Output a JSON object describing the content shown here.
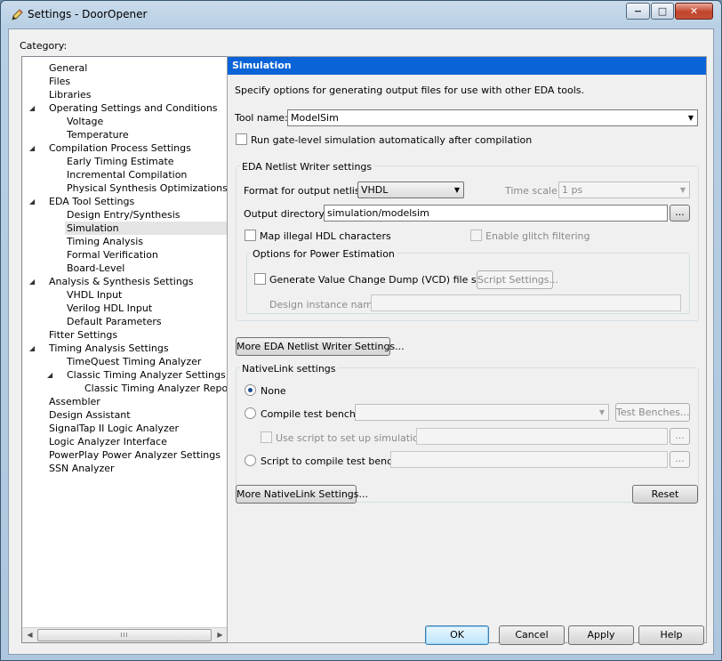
{
  "window": {
    "title": "Settings - DoorOpener",
    "controls": {
      "minimize": "−",
      "maximize": "□",
      "close": "✕"
    },
    "title_icon": "pencil-icon"
  },
  "category": {
    "label": "Category:",
    "items": [
      {
        "label": "General",
        "level": 0
      },
      {
        "label": "Files",
        "level": 0
      },
      {
        "label": "Libraries",
        "level": 0
      },
      {
        "label": "Operating Settings and Conditions",
        "level": 0,
        "expanded": true
      },
      {
        "label": "Voltage",
        "level": 1
      },
      {
        "label": "Temperature",
        "level": 1
      },
      {
        "label": "Compilation Process Settings",
        "level": 0,
        "expanded": true
      },
      {
        "label": "Early Timing Estimate",
        "level": 1
      },
      {
        "label": "Incremental Compilation",
        "level": 1
      },
      {
        "label": "Physical Synthesis Optimizations",
        "level": 1
      },
      {
        "label": "EDA Tool Settings",
        "level": 0,
        "expanded": true
      },
      {
        "label": "Design Entry/Synthesis",
        "level": 1
      },
      {
        "label": "Simulation",
        "level": 1,
        "selected": true
      },
      {
        "label": "Timing Analysis",
        "level": 1
      },
      {
        "label": "Formal Verification",
        "level": 1
      },
      {
        "label": "Board-Level",
        "level": 1
      },
      {
        "label": "Analysis & Synthesis Settings",
        "level": 0,
        "expanded": true
      },
      {
        "label": "VHDL Input",
        "level": 1
      },
      {
        "label": "Verilog HDL Input",
        "level": 1
      },
      {
        "label": "Default Parameters",
        "level": 1
      },
      {
        "label": "Fitter Settings",
        "level": 0
      },
      {
        "label": "Timing Analysis Settings",
        "level": 0,
        "expanded": true
      },
      {
        "label": "TimeQuest Timing Analyzer",
        "level": 1
      },
      {
        "label": "Classic Timing Analyzer Settings",
        "level": 1,
        "expanded": true
      },
      {
        "label": "Classic Timing Analyzer Reporting",
        "level": 2
      },
      {
        "label": "Assembler",
        "level": 0
      },
      {
        "label": "Design Assistant",
        "level": 0
      },
      {
        "label": "SignalTap II Logic Analyzer",
        "level": 0
      },
      {
        "label": "Logic Analyzer Interface",
        "level": 0
      },
      {
        "label": "PowerPlay Power Analyzer Settings",
        "level": 0
      },
      {
        "label": "SSN Analyzer",
        "level": 0
      }
    ],
    "scroll_thumb": "III",
    "scroll_left": "◀",
    "scroll_right": "▶"
  },
  "panel": {
    "header": "Simulation",
    "description": "Specify options for generating output files for use with other EDA tools.",
    "tool_name_label": "Tool name:",
    "tool_name_value": "ModelSim",
    "run_gate_level_label": "Run gate-level simulation automatically after compilation",
    "eda_netlist": {
      "title": "EDA Netlist Writer settings",
      "format_label": "Format for output netlist:",
      "format_value": "VHDL",
      "time_scale_label": "Time scale:",
      "time_scale_value": "1 ps",
      "output_dir_label": "Output directory:",
      "output_dir_value": "simulation/modelsim",
      "browse": "...",
      "map_illegal_label": "Map illegal HDL characters",
      "enable_glitch_label": "Enable glitch filtering",
      "power": {
        "title": "Options for Power Estimation",
        "vcd_label": "Generate Value Change Dump (VCD) file script",
        "script_settings": "Script Settings...",
        "design_instance_label": "Design instance name:"
      }
    },
    "more_eda_button": "More EDA Netlist Writer Settings...",
    "nativelink": {
      "title": "NativeLink settings",
      "none_label": "None",
      "compile_tb_label": "Compile test bench:",
      "test_benches_button": "Test Benches...",
      "use_script_label": "Use script to set up simulation:",
      "browse": "...",
      "script_compile_label": "Script to compile test bench:"
    },
    "more_nativelink_button": "More NativeLink Settings...",
    "reset_button": "Reset"
  },
  "footer": {
    "ok": "OK",
    "cancel": "Cancel",
    "apply": "Apply",
    "help": "Help"
  },
  "colors": {
    "header_blue": "#0a64d8",
    "selection_gray": "#e5e5e5"
  }
}
